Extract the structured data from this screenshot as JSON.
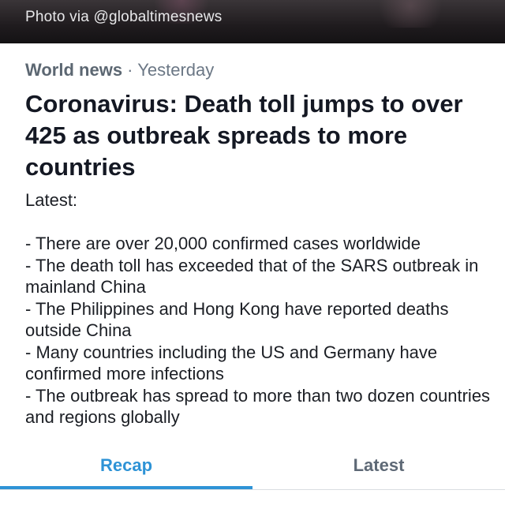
{
  "photo": {
    "credit": "Photo via @globaltimesnews"
  },
  "meta": {
    "category": "World news",
    "separator": " · ",
    "time": "Yesterday"
  },
  "headline": "Coronavirus: Death toll jumps to over 425 as outbreak spreads to more countries",
  "body": "Latest:\n\n- There are over 20,000 confirmed cases worldwide\n- The death toll has exceeded that of the SARS outbreak in mainland China\n- The Philippines and Hong Kong have reported deaths outside China\n- Many countries including the US and Germany have confirmed more infections\n- The outbreak has spread to more than two dozen countries and regions globally",
  "tabs": [
    {
      "label": "Recap",
      "active": true
    },
    {
      "label": "Latest",
      "active": false
    }
  ],
  "colors": {
    "accent": "#2e93d6",
    "headline": "#141823",
    "meta": "#6b7785"
  }
}
